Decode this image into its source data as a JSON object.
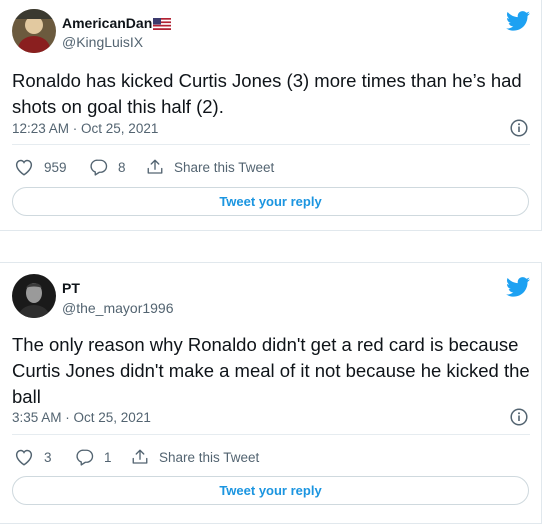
{
  "tweets": [
    {
      "name": "AmericanDan",
      "handle": "@KingLuisIX",
      "text": "Ronaldo has kicked Curtis Jones (3) more times than he’s had shots on goal this half (2).",
      "timestamp": "12:23 AM · Oct 25, 2021",
      "likes": "959",
      "replies": "8",
      "share_label": "Share this Tweet",
      "reply_label": "Tweet your reply"
    },
    {
      "name": "PT",
      "handle": "@the_mayor1996",
      "text": "The only reason why Ronaldo didn't get a red card is because Curtis Jones didn't make a meal of it not because he kicked the ball",
      "timestamp": "3:35 AM · Oct 25, 2021",
      "likes": "3",
      "replies": "1",
      "share_label": "Share this Tweet",
      "reply_label": "Tweet your reply"
    }
  ],
  "colors": {
    "twitter_blue": "#1da1f2",
    "link_blue": "#1b95e0",
    "secondary_text": "#536471",
    "border": "#cfd9de"
  },
  "icons": [
    "twitter-bird-icon",
    "info-icon",
    "heart-icon",
    "reply-icon",
    "share-icon",
    "us-flag-icon"
  ]
}
